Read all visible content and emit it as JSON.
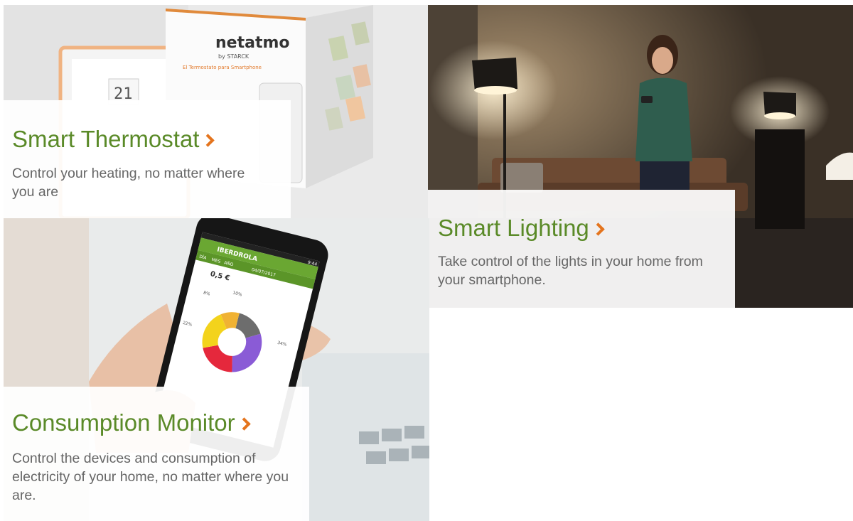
{
  "brand_colors": {
    "title": "#5a8a28",
    "chevron": "#e4741d",
    "description": "#666666"
  },
  "products": [
    {
      "title": "Smart Thermostat",
      "description": "Control your heating, no matter where you are",
      "link_icon": "chevron-right-icon",
      "image_text": {
        "brand": "netatmo",
        "sub": "by STARCK",
        "box_caption": "El Termostato para Smartphone",
        "display": "21"
      }
    },
    {
      "title": "Smart Lighting",
      "description": "Take control of the lights in your home from your smartphone.",
      "link_icon": "chevron-right-icon"
    },
    {
      "title": "Consumption Monitor",
      "description": "Control the devices and consumption of electricity of your home, no matter where you are.",
      "link_icon": "chevron-right-icon",
      "phone_screen": {
        "app_name": "IBERDROLA",
        "time": "9:44",
        "tabs": [
          "DÍA",
          "MES",
          "AÑO"
        ],
        "date": "04/07/2017",
        "amount": "0,5 €",
        "donut_labels": [
          "10%",
          "8%",
          "22%",
          "34%"
        ]
      }
    }
  ]
}
